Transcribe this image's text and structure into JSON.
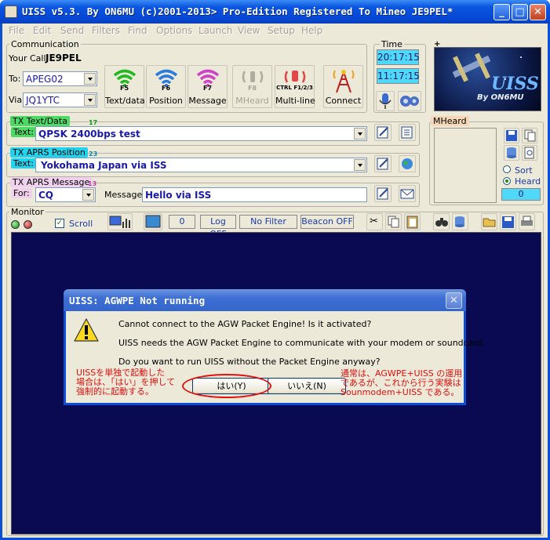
{
  "window": {
    "title": "UISS v5.3. By ON6MU (c)2001-2013> Pro-Edition Registered To Mineo JE9PEL*",
    "minimize": "_",
    "maximize": "□",
    "close": "✕"
  },
  "menu": [
    "File",
    "Edit",
    "Send",
    "Filters",
    "Find",
    "Options",
    "Launch",
    "View",
    "Setup",
    "Help"
  ],
  "communication": {
    "label": "Communication",
    "your_call_label": "Your Call:",
    "your_call": "JE9PEL",
    "to_label": "To:",
    "to_value": "APEG02",
    "via_label": "Via:",
    "via_value": "JQ1YTC",
    "buttons": [
      {
        "key": "F5",
        "label": "Text/data"
      },
      {
        "key": "F6",
        "label": "Position"
      },
      {
        "key": "F7",
        "label": "Message"
      },
      {
        "key": "F8",
        "label": "MHeard"
      },
      {
        "key": "CTRL F1/2/3",
        "label": "Multi-line"
      },
      {
        "key": "",
        "label": "Connect"
      }
    ]
  },
  "time": {
    "label": "Time",
    "utc": "20:17:15",
    "local": "11:17:15"
  },
  "logo": {
    "corner": "+",
    "text": "UISS",
    "sub": "By ON6MU"
  },
  "tx_text": {
    "label": "TX Text/Data",
    "count": "17",
    "field_label": "Text:",
    "value": "QPSK 2400bps test"
  },
  "tx_position": {
    "label": "TX APRS Position",
    "count": "23",
    "field_label": "Text:",
    "value": "Yokohama Japan via ISS"
  },
  "tx_message": {
    "label": "TX APRS Message",
    "count": "13",
    "for_label": "For:",
    "for_value": "CQ",
    "message_label": "Message:",
    "message_value": "Hello via ISS"
  },
  "mheard": {
    "label": "MHeard",
    "sort": "Sort",
    "heard": "Heard",
    "count": "0"
  },
  "monitor": {
    "label": "Monitor",
    "scroll": "Scroll",
    "counter": "0",
    "log": "Log OFF",
    "filter": "No Filter",
    "beacon": "Beacon OFF"
  },
  "dialog": {
    "title": "UISS: AGWPE Not running",
    "close": "✕",
    "line1": "Cannot connect to the AGW Packet Engine! Is it activated?",
    "line2": "UISS needs the AGW Packet Engine to communicate with your modem or soundcard.",
    "line3": "Do you want to run UISS without the Packet Engine anyway?",
    "yes": "はい(Y)",
    "no": "いいえ(N)",
    "note_left": [
      "UISSを単独で起動した",
      "場合は、「はい」を押して",
      "強制的に起動する。"
    ],
    "note_right": [
      "通常は、AGWPE+UISS の運用",
      "であるが、これから行う実験は",
      "Sounmodem+UISS である。"
    ]
  },
  "colors": {
    "accent_green": "#4cd964",
    "accent_cyan": "#22d3ee",
    "accent_pink": "#f0a0e0",
    "time_bg": "#4fd8f8",
    "monitor_bg": "#0a0a52",
    "red_note": "#e01010"
  }
}
